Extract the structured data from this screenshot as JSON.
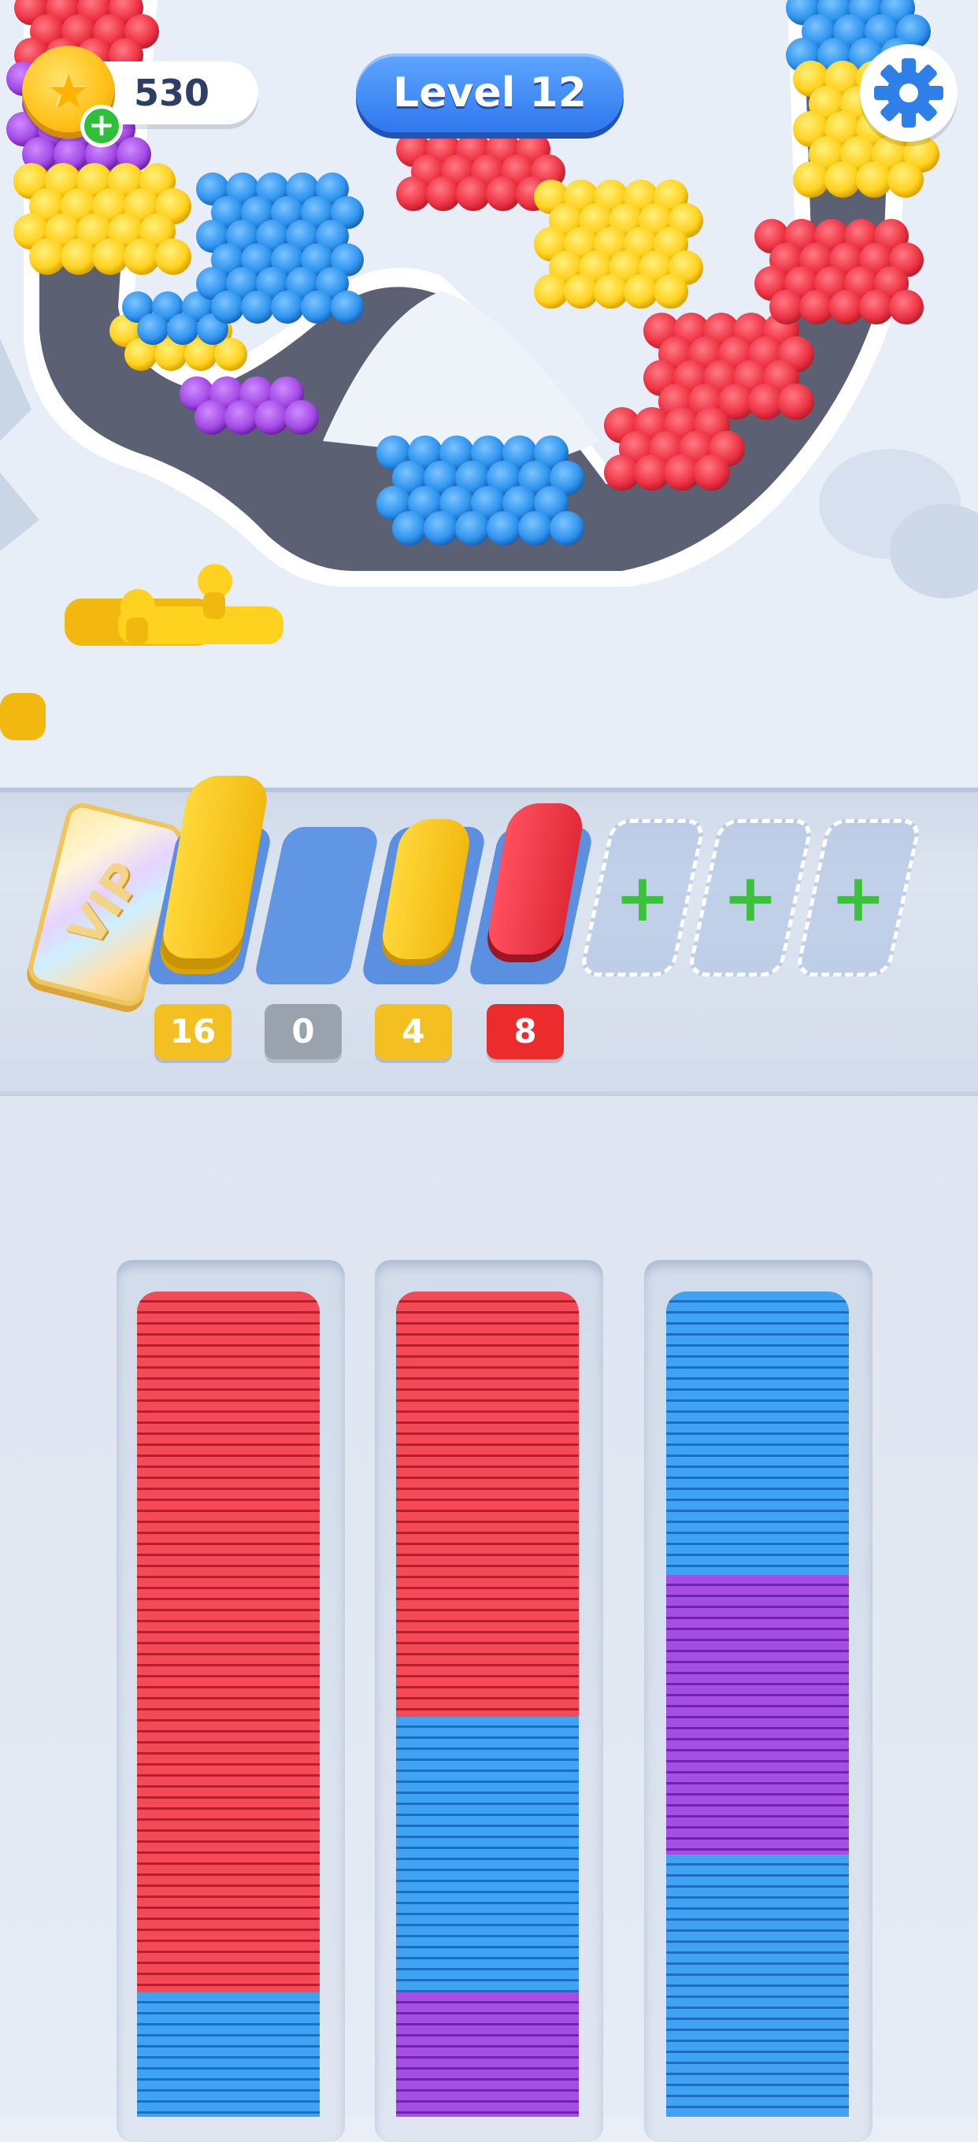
{
  "hud": {
    "coins": "530",
    "level": "Level 12"
  },
  "colors": {
    "red": "#f24a56",
    "blue": "#3fa2f2",
    "yellow": "#ffd21f",
    "purple": "#a54ee6",
    "accent": "#2f78ee"
  },
  "tray": {
    "vip_label": "VIP",
    "slots": [
      {
        "color": "yellow",
        "count": "16",
        "badge_color": "#f4c021"
      },
      {
        "color": "none",
        "count": "0",
        "badge_color": "#9aa3ad"
      },
      {
        "color": "yellow",
        "count": "4",
        "badge_color": "#f4c021"
      },
      {
        "color": "red",
        "count": "8",
        "badge_color": "#ec2c2c"
      }
    ],
    "locked_slots": [
      "+",
      "+",
      "+"
    ]
  },
  "stacks": [
    {
      "segments": [
        "red",
        "blue"
      ]
    },
    {
      "segments": [
        "red",
        "blue",
        "purple"
      ]
    },
    {
      "segments": [
        "blue",
        "purple",
        "blue"
      ]
    }
  ],
  "icons": [
    "star-icon",
    "plus-icon",
    "gear-icon"
  ]
}
